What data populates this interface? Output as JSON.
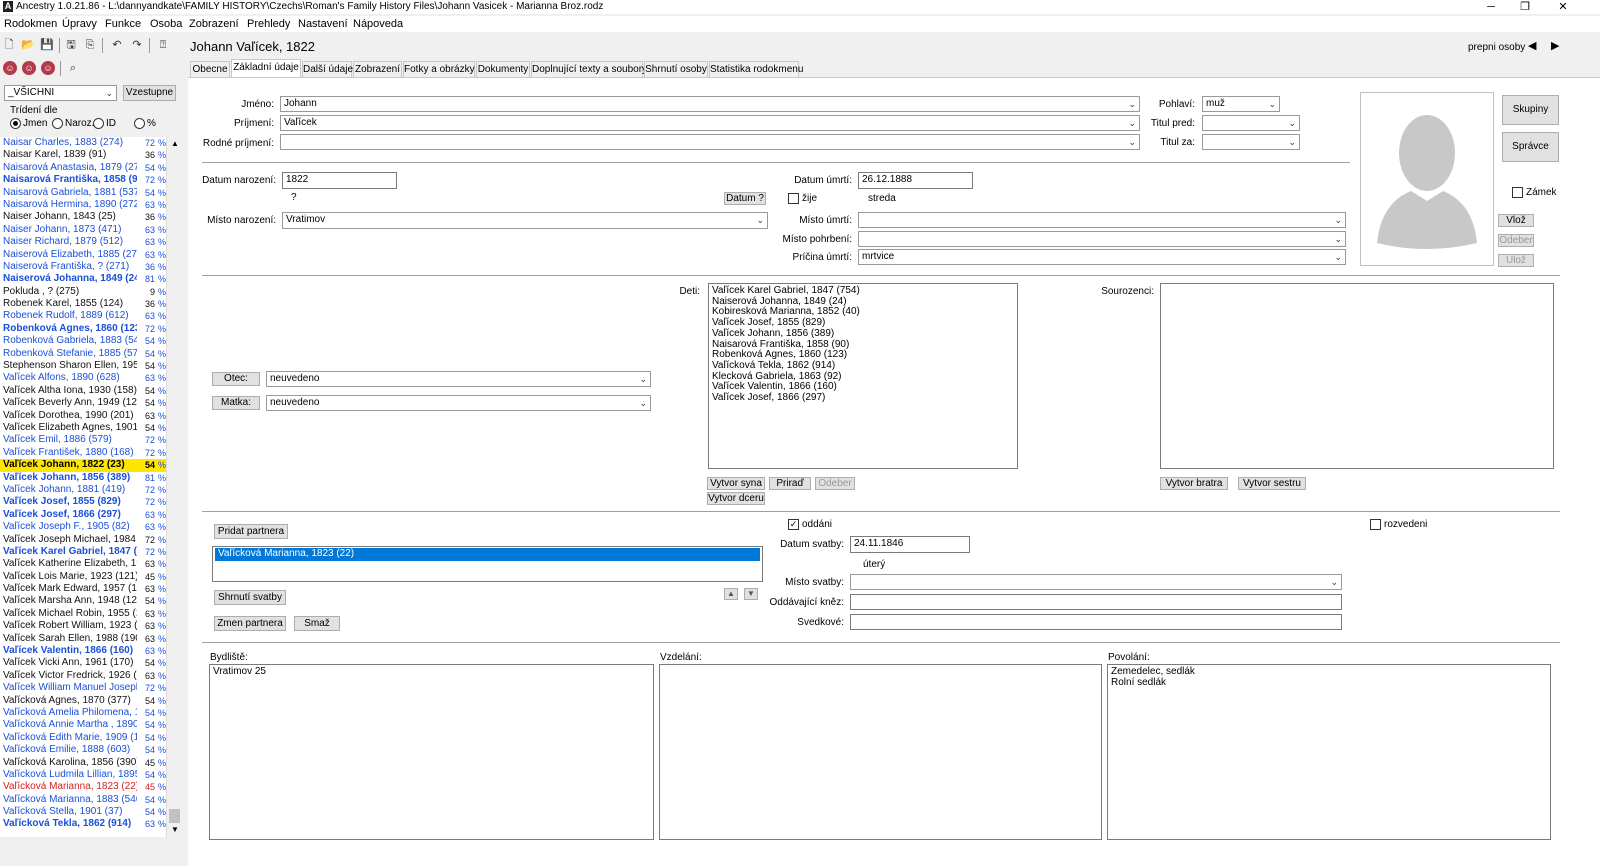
{
  "window": {
    "title": "Ancestry 1.0.21.86 - L:\\dannyandkate\\FAMILY HISTORY\\Czechs\\Roman's Family History Files\\Johann Vasicek - Marianna Broz.rodz",
    "minimize": "─",
    "restore": "❐",
    "close": "✕"
  },
  "menu": [
    "Rodokmen",
    "Úpravy",
    "Funkce",
    "Osoba",
    "Zobrazení",
    "Prehledy",
    "Nastavení",
    "Nápoveda"
  ],
  "left": {
    "filter": "_VŠICHNI",
    "sort_button": "Vzestupne",
    "sort_label": "Trídení dle",
    "sort_options": [
      "Jmen",
      "Naroz.",
      "ID",
      "%"
    ],
    "sort_selected": "Jmen",
    "people": [
      {
        "name": "Naisar Charles, 1883 (274)",
        "score": "72",
        "style": "blue"
      },
      {
        "name": "Naisar Karel, 1839 (91)",
        "score": "36",
        "style": "black"
      },
      {
        "name": "Naisarová Anastasia, 1879 (273)",
        "score": "54",
        "style": "blue"
      },
      {
        "name": "Naisarová Františka, 1858 (90)",
        "score": "72",
        "style": "blue bold"
      },
      {
        "name": "Naisarová Gabriela, 1881 (537)",
        "score": "54",
        "style": "blue"
      },
      {
        "name": "Naisarová Hermina, 1890 (272)",
        "score": "63",
        "style": "blue"
      },
      {
        "name": "Naiser Johann, 1843 (25)",
        "score": "36",
        "style": "black"
      },
      {
        "name": "Naiser Johann, 1873 (471)",
        "score": "63",
        "style": "blue"
      },
      {
        "name": "Naiser Richard, 1879 (512)",
        "score": "63",
        "style": "blue"
      },
      {
        "name": "Naiserová Elizabeth, 1885 (270)",
        "score": "63",
        "style": "blue"
      },
      {
        "name": "Naiserová Františka, ? (271)",
        "score": "36",
        "style": "blue"
      },
      {
        "name": "Naiserová Johanna, 1849 (24)",
        "score": "81",
        "style": "blue bold"
      },
      {
        "name": "Pokluda , ? (275)",
        "score": "9",
        "style": "black"
      },
      {
        "name": "Robenek Karel, 1855 (124)",
        "score": "36",
        "style": "black"
      },
      {
        "name": "Robenek Rudolf, 1889 (612)",
        "score": "63",
        "style": "blue"
      },
      {
        "name": "Robenková Agnes, 1860 (123)",
        "score": "72",
        "style": "blue bold"
      },
      {
        "name": "Robenková Gabriela, 1883 (547)",
        "score": "54",
        "style": "blue"
      },
      {
        "name": "Robenková Stefanie, 1885 (574)",
        "score": "54",
        "style": "blue"
      },
      {
        "name": "Stephenson Sharon Ellen, 1959 (1",
        "score": "54",
        "style": "black"
      },
      {
        "name": "Vaľícek Alfons, 1890 (628)",
        "score": "63",
        "style": "blue"
      },
      {
        "name": "Vaľícek Altha Iona, 1930 (158)",
        "score": "54",
        "style": "black"
      },
      {
        "name": "Vaľícek Beverly Ann, 1949 (126)",
        "score": "54",
        "style": "black"
      },
      {
        "name": "Vaľícek Dorothea, 1990 (201)",
        "score": "63",
        "style": "black"
      },
      {
        "name": "Vaľícek Elizabeth Agnes, 1901 (1",
        "score": "54",
        "style": "black"
      },
      {
        "name": "Vaľícek Emil, 1886 (579)",
        "score": "72",
        "style": "blue"
      },
      {
        "name": "Vaľícek František, 1880 (168)",
        "score": "72",
        "style": "blue"
      },
      {
        "name": "Vaľícek Johann, 1822 (23)",
        "score": "54",
        "style": "hl"
      },
      {
        "name": "Vaľícek Johann, 1856 (389)",
        "score": "81",
        "style": "blue bold"
      },
      {
        "name": "Vaľícek Johann, 1881 (419)",
        "score": "72",
        "style": "blue"
      },
      {
        "name": "Vaľícek Josef, 1855 (829)",
        "score": "72",
        "style": "blue bold"
      },
      {
        "name": "Vaľícek Josef, 1866 (297)",
        "score": "63",
        "style": "blue bold"
      },
      {
        "name": "Vaľícek Joseph F., 1905 (82)",
        "score": "63",
        "style": "blue"
      },
      {
        "name": "Vaľícek Joseph Michael, 1984 (1",
        "score": "72",
        "style": "black"
      },
      {
        "name": "Vaľícek Karel Gabriel, 1847 (754)",
        "score": "72",
        "style": "blue bold"
      },
      {
        "name": "Vaľícek Katherine Elizabeth, 1988",
        "score": "63",
        "style": "black"
      },
      {
        "name": "Vaľícek Lois Marie, 1923 (121)",
        "score": "45",
        "style": "black"
      },
      {
        "name": "Vaľícek Mark Edward, 1957 (169)",
        "score": "63",
        "style": "black"
      },
      {
        "name": "Vaľícek Marsha Ann, 1948 (125)",
        "score": "54",
        "style": "black"
      },
      {
        "name": "Vaľícek Michael Robin, 1955 (15",
        "score": "63",
        "style": "black"
      },
      {
        "name": "Vaľícek Robert William, 1923 (11",
        "score": "63",
        "style": "black"
      },
      {
        "name": "Vaľícek Sarah Ellen, 1988 (190)",
        "score": "63",
        "style": "black"
      },
      {
        "name": "Vaľícek Valentin, 1866 (160)",
        "score": "63",
        "style": "blue bold"
      },
      {
        "name": "Vaľícek Vicki Ann, 1961 (170)",
        "score": "54",
        "style": "black"
      },
      {
        "name": "Vaľícek Victor Fredrick, 1926 (12",
        "score": "63",
        "style": "black"
      },
      {
        "name": "Vaľícek William Manuel Joseph, 1",
        "score": "72",
        "style": "blue"
      },
      {
        "name": "Vaľícková Agnes, 1870 (377)",
        "score": "54",
        "style": "black"
      },
      {
        "name": "Vaľícková Amelia Philomena, 189",
        "score": "54",
        "style": "blue"
      },
      {
        "name": "Vaľícková Annie Martha , 1890 (1",
        "score": "54",
        "style": "blue"
      },
      {
        "name": "Vaľícková Edith Marie, 1909 (102",
        "score": "54",
        "style": "blue"
      },
      {
        "name": "Vaľícková Emilie, 1888 (603)",
        "score": "54",
        "style": "blue"
      },
      {
        "name": "Vaľícková Karolina, 1856 (390)",
        "score": "45",
        "style": "black"
      },
      {
        "name": "Vaľícková Ludmila Lillian, 1895 (",
        "score": "54",
        "style": "blue"
      },
      {
        "name": "Vaľícková Marianna, 1823 (22)",
        "score": "45",
        "style": "red"
      },
      {
        "name": "Vaľícková Marianna, 1883 (546)",
        "score": "54",
        "style": "blue"
      },
      {
        "name": "Vaľícková Stella, 1901 (37)",
        "score": "54",
        "style": "blue"
      },
      {
        "name": "Vaľícková Tekla, 1862 (914)",
        "score": "63",
        "style": "blue bold"
      }
    ]
  },
  "main": {
    "heading": "Johann Vaľícek, 1822",
    "switch_label": "prepni osoby",
    "tabs": [
      "Obecne",
      "Základní údaje",
      "Další údaje",
      "Zobrazení",
      "Fotky a obrázky",
      "Dokumenty",
      "Doplnující texty a soubory",
      "Shrnutí osoby",
      "Statistika rodokmenu"
    ],
    "active_tab": 1,
    "name": {
      "first_label": "Jméno:",
      "first": "Johann",
      "surname_label": "Príjmení:",
      "surname": "Vaľícek",
      "birthname_label": "Rodné príjmení:",
      "birthname": "",
      "sex_label": "Pohlaví:",
      "sex": "muž",
      "title_before_label": "Titul pred:",
      "title_before": "",
      "title_after_label": "Titul za:",
      "title_after": ""
    },
    "side_buttons": {
      "groups": "Skupiny",
      "admin": "Správce",
      "lock": "Zámek",
      "insert": "Vlož",
      "remove": "Odeber",
      "save": "Ulož"
    },
    "birth": {
      "date_label": "Datum narození:",
      "date": "1822",
      "weekday": "?",
      "date_button": "Datum ?",
      "place_label": "Místo narození:",
      "place": "Vratimov"
    },
    "death": {
      "date_label": "Datum úmrtí:",
      "date": "26.12.1888",
      "alive_label": "žije",
      "weekday": "streda",
      "place_label": "Místo úmrtí:",
      "place": "",
      "burial_label": "Místo pohrbení:",
      "burial": "",
      "cause_label": "Príčina úmrtí:",
      "cause": "mrtvice"
    },
    "parents": {
      "father_button": "Otec:",
      "father": "neuvedeno",
      "mother_button": "Matka:",
      "mother": "neuvedeno"
    },
    "children": {
      "label": "Deti:",
      "list": [
        "Vaľícek Karel Gabriel, 1847 (754)",
        "Naiserová Johanna, 1849 (24)",
        "Kobiresková Marianna, 1852 (40)",
        "Vaľícek Josef, 1855 (829)",
        "Vaľícek Johann, 1856 (389)",
        "Naisarová Františka, 1858 (90)",
        "Robenková Agnes, 1860 (123)",
        "Vaľícková Tekla, 1862 (914)",
        "Klecková Gabriela, 1863 (92)",
        "Vaľícek Valentin, 1866 (160)",
        "Vaľícek Josef, 1866 (297)"
      ],
      "make_son": "Vytvor syna",
      "assign": "Priraď",
      "remove": "Odeber",
      "make_daughter": "Vytvor dceru"
    },
    "siblings": {
      "label": "Sourozenci:",
      "make_brother": "Vytvor bratra",
      "make_sister": "Vytvor sestru"
    },
    "partner": {
      "add": "Pridat partnera",
      "selected": "Vaľícková Marianna, 1823 (22)",
      "wedding_summary": "Shrnutí svatby",
      "change": "Zmen partnera",
      "delete": "Smaž",
      "married_label": "oddáni",
      "divorced_label": "rozvedeni",
      "wedding_date_label": "Datum svatby:",
      "wedding_date": "24.11.1846",
      "wedding_weekday": "úterý",
      "wedding_place_label": "Místo svatby:",
      "wedding_place": "",
      "priest_label": "Oddávající kněz:",
      "priest": "",
      "witnesses_label": "Svedkové:",
      "witnesses": ""
    },
    "bottom": {
      "residence_label": "Bydliště:",
      "residence": "Vratimov 25",
      "education_label": "Vzdelání:",
      "education": "",
      "occupation_label": "Povolání:",
      "occupation_lines": [
        "Zemedelec, sedlák",
        "Rolní sedlák"
      ]
    }
  }
}
